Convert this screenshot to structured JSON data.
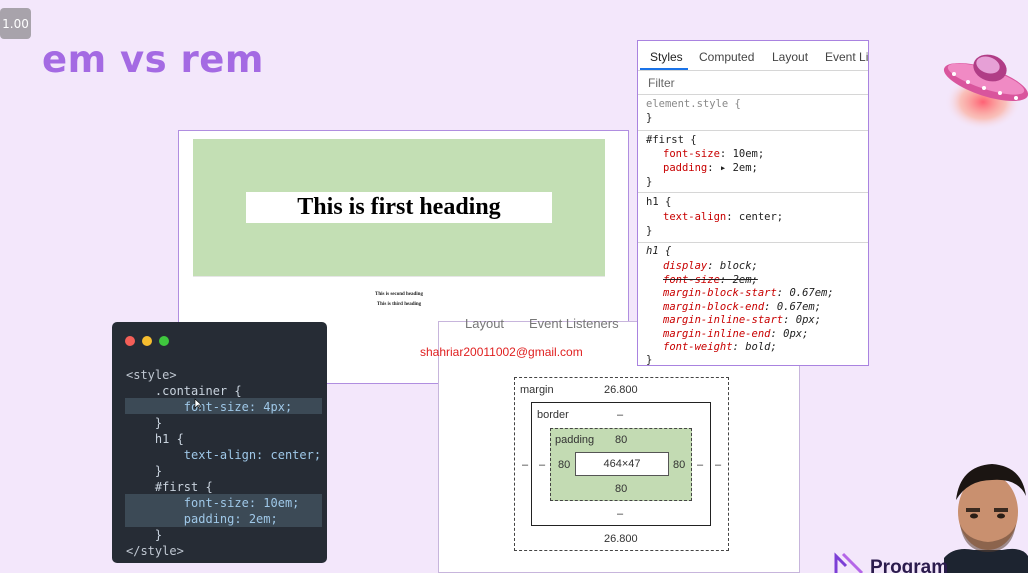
{
  "zoom": "1.00",
  "title": "em vs rem",
  "preview": {
    "heading1": "This is first heading",
    "heading2": "This is second heading",
    "heading3": "This is third heading"
  },
  "code": {
    "lines": [
      "<style>",
      "    .container {",
      "        font-size: 4px;",
      "    }",
      "    h1 {",
      "        text-align: center;",
      "    }",
      "    #first {",
      "        font-size: 10em;",
      "        padding: 2em;",
      "    }",
      "</style>"
    ]
  },
  "devtools": {
    "tabs": [
      "Styles",
      "Computed",
      "Layout",
      "Event Lis"
    ],
    "active_tab": "Styles",
    "filter_placeholder": "Filter",
    "rules": [
      {
        "selector": "element.style {",
        "decls": [],
        "close": "}"
      },
      {
        "selector": "#first {",
        "decls": [
          {
            "prop": "font-size",
            "value": "10em;"
          },
          {
            "prop": "padding",
            "value": "▸ 2em;"
          }
        ],
        "close": "}"
      },
      {
        "selector": "h1 {",
        "decls": [
          {
            "prop": "text-align",
            "value": "center;"
          }
        ],
        "close": "}"
      },
      {
        "selector": "h1 {",
        "decls": [
          {
            "prop": "display",
            "value": "block;"
          },
          {
            "prop": "font-size",
            "value": "2em;"
          },
          {
            "prop": "margin-block-start",
            "value": "0.67em;"
          },
          {
            "prop": "margin-block-end",
            "value": "0.67em;"
          },
          {
            "prop": "margin-inline-start",
            "value": "0px;"
          },
          {
            "prop": "margin-inline-end",
            "value": "0px;"
          },
          {
            "prop": "font-weight",
            "value": "bold;"
          }
        ],
        "close": "}"
      }
    ]
  },
  "boxmodel": {
    "tabs": [
      "Layout",
      "Event Listeners"
    ],
    "margin_label": "margin",
    "margin_top": "26.800",
    "margin_bottom": "26.800",
    "margin_left": "–",
    "margin_right": "–",
    "border_label": "border",
    "border_top": "–",
    "border_bottom": "–",
    "border_left": "–",
    "border_right": "–",
    "padding_label": "padding",
    "padding_top": "80",
    "padding_bottom": "80",
    "padding_left": "80",
    "padding_right": "80",
    "content_size": "464×47"
  },
  "watermark_email": "shahriar20011002@gmail.com",
  "brand": "Program",
  "colors": {
    "background": "#f3e7fb",
    "title": "#a46ae3",
    "preview_green": "#c3dfb4",
    "code_bg": "#262c35",
    "css_property": "#c80000"
  }
}
